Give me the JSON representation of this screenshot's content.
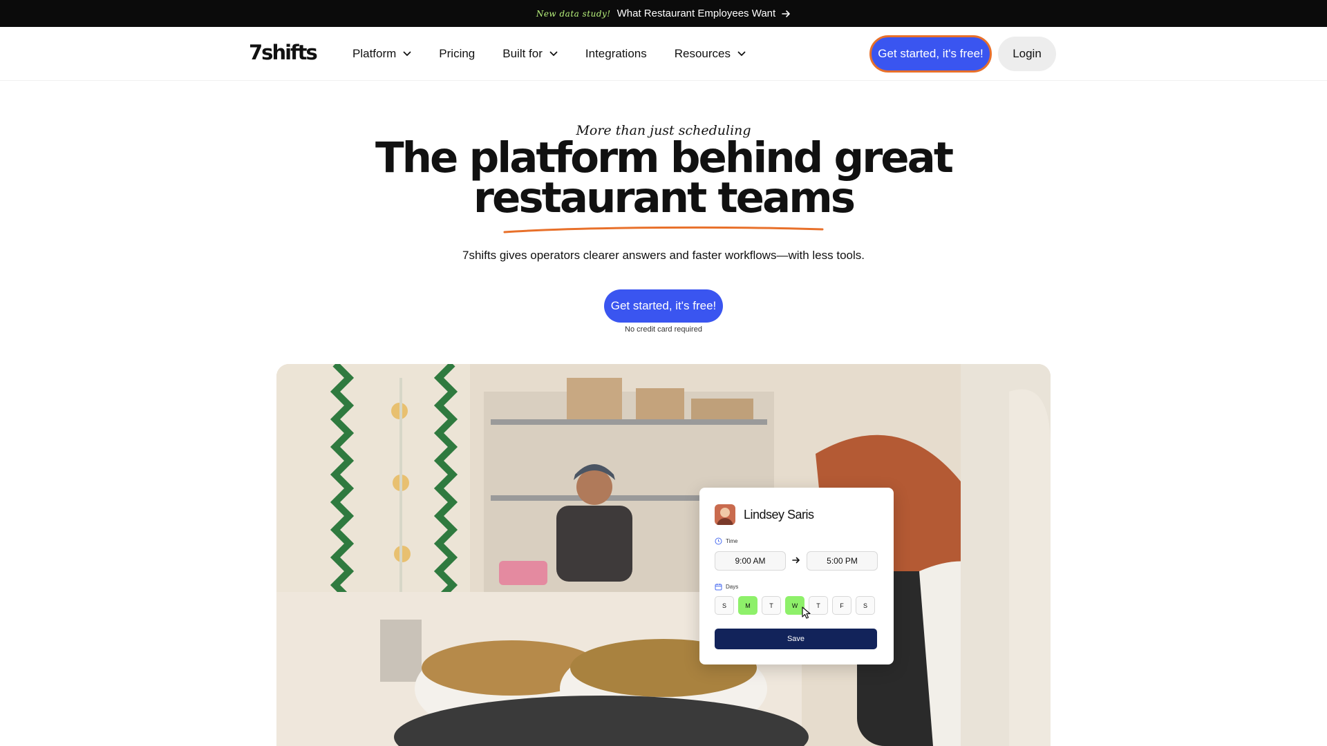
{
  "announcement": {
    "tag": "New data study!",
    "text": "What Restaurant Employees Want",
    "icon": "arrow-right-icon"
  },
  "nav": {
    "logo": "7shifts",
    "items": [
      {
        "label": "Platform",
        "has_dropdown": true
      },
      {
        "label": "Pricing",
        "has_dropdown": false
      },
      {
        "label": "Built for",
        "has_dropdown": true
      },
      {
        "label": "Integrations",
        "has_dropdown": false
      },
      {
        "label": "Resources",
        "has_dropdown": true
      }
    ],
    "cta_label": "Get started, it's free!",
    "login_label": "Login"
  },
  "hero": {
    "eyebrow": "More than just scheduling",
    "headline_line1": "The platform behind great",
    "headline_line2": "restaurant teams",
    "subtext": "7shifts gives operators clearer answers and faster workflows—with less tools.",
    "cta_label": "Get started, it's free!",
    "note": "No credit card required"
  },
  "schedule_card": {
    "name": "Lindsey Saris",
    "time_label": "Time",
    "start_time": "9:00 AM",
    "end_time": "5:00 PM",
    "days_label": "Days",
    "days": [
      {
        "label": "S",
        "selected": false
      },
      {
        "label": "M",
        "selected": true
      },
      {
        "label": "T",
        "selected": false
      },
      {
        "label": "W",
        "selected": true
      },
      {
        "label": "T",
        "selected": false
      },
      {
        "label": "F",
        "selected": false
      },
      {
        "label": "S",
        "selected": false
      }
    ],
    "save_label": "Save"
  },
  "colors": {
    "brand_blue": "#3a55f0",
    "accent_orange": "#e8702a",
    "day_selected": "#8ef06a",
    "save_navy": "#12235a",
    "announce_bg": "#0b0b0b"
  }
}
